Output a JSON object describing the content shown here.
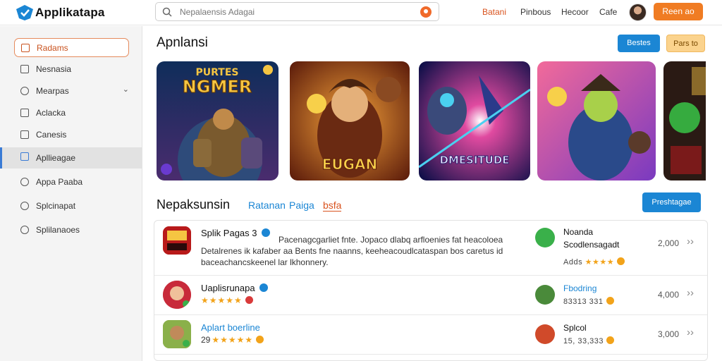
{
  "app": {
    "brand": "Applikatapa"
  },
  "search": {
    "placeholder": "Nepalaensis Adagai"
  },
  "nav": [
    {
      "label": "Batani"
    },
    {
      "label": "Pinbous"
    },
    {
      "label": "Hecoor"
    },
    {
      "label": "Cafe"
    }
  ],
  "header": {
    "cta_label": "Reen ao"
  },
  "sidebar": {
    "items": [
      {
        "label": "Radams"
      },
      {
        "label": "Nesnasia"
      },
      {
        "label": "Mearpas"
      },
      {
        "label": "Aclacka"
      },
      {
        "label": "Canesis"
      },
      {
        "label": "Apllieagae"
      },
      {
        "label": "Appa Paaba"
      },
      {
        "label": "Splcinapat"
      },
      {
        "label": "Splilanaoes"
      }
    ]
  },
  "featured": {
    "title": "Apnlansi",
    "btn_primary": "Bestes",
    "btn_secondary": "Pars to",
    "cards": [
      {
        "art_title": "NGMER",
        "art_sub": "PURTES"
      },
      {
        "art_title": "EUGAN"
      },
      {
        "art_title": "DMESITUDE"
      },
      {
        "art_title": ""
      },
      {
        "art_title": ""
      }
    ]
  },
  "listing": {
    "title": "Nepaksunsin",
    "tabs": [
      {
        "label": "Ratanan"
      },
      {
        "label": "Paiga"
      },
      {
        "label": "bsfa"
      }
    ],
    "action_label": "Preshtagae",
    "rows": [
      {
        "name": "Splik Pagas 3",
        "desc_line1": "Pacenagcgarliet fnte. Jopaco dlabq arfloenies fat heacoloea",
        "desc_line2": "Detalrenes ik kafaber aa Bents fne naanns, keeheacoudlcataspan bos caretus id",
        "desc_line3": "baceachancskeenel lar lkhonnery.",
        "dev_name": "Noanda",
        "dev_name2": "Scodlensagadt",
        "dev_meta": "Adds",
        "price": "2,000"
      },
      {
        "name": "Uaplisrunapa",
        "dev_name": "Fbodring",
        "dev_meta": "83313 331",
        "price": "4,000"
      },
      {
        "name": "Aplart boerline",
        "stars_num": "29",
        "dev_name": "Splcol",
        "dev_meta": "15, 33,333",
        "price": "3,000"
      }
    ]
  },
  "colors": {
    "accent_orange": "#f07c23",
    "accent_blue": "#1b86d4",
    "star": "#f2a31a"
  }
}
